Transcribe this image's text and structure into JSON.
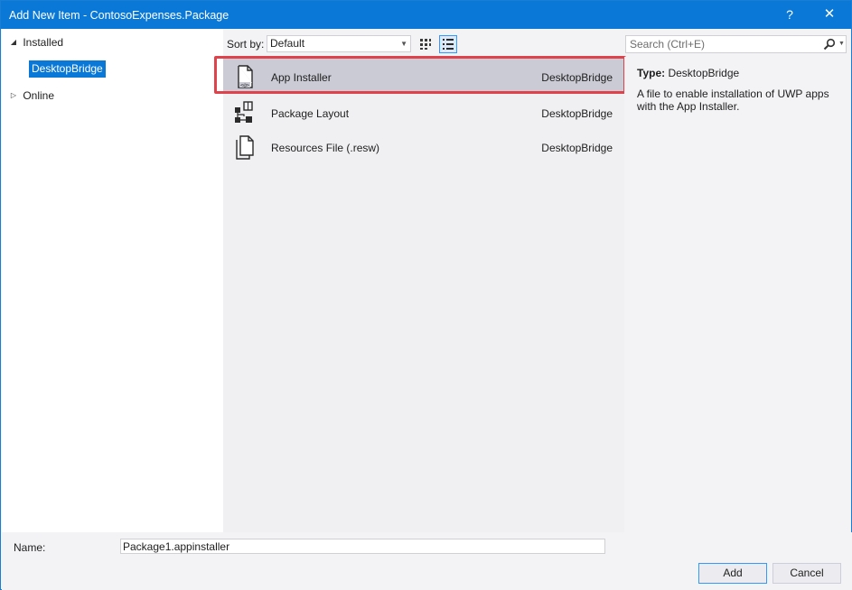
{
  "window": {
    "title": "Add New Item - ContosoExpenses.Package",
    "help_label": "?",
    "close_label": "✕"
  },
  "tree": {
    "installed": {
      "label": "Installed",
      "arrow": "◢"
    },
    "desktop_bridge": {
      "label": "DesktopBridge"
    },
    "online": {
      "label": "Online",
      "arrow": "▷"
    }
  },
  "toolbar": {
    "sort_label": "Sort by:",
    "sort_value": "Default",
    "sort_arrow": "▼",
    "search_placeholder": "Search (Ctrl+E)",
    "search_drop": "▼"
  },
  "items": [
    {
      "name": "App Installer",
      "type": "DesktopBridge",
      "icon": "app-installer-icon",
      "selected": true
    },
    {
      "name": "Package Layout",
      "type": "DesktopBridge",
      "icon": "package-layout-icon",
      "selected": false
    },
    {
      "name": "Resources File (.resw)",
      "type": "DesktopBridge",
      "icon": "resources-file-icon",
      "selected": false
    }
  ],
  "details": {
    "type_label": "Type:",
    "type_value": "DesktopBridge",
    "description": "A file to enable installation of UWP apps with the App Installer."
  },
  "bottom": {
    "name_label": "Name:",
    "name_value": "Package1.appinstaller",
    "add_label": "Add",
    "cancel_label": "Cancel"
  },
  "colors": {
    "title_bar": "#0a78d7",
    "selection": "#cacbd4",
    "highlight": "#e0424b"
  }
}
